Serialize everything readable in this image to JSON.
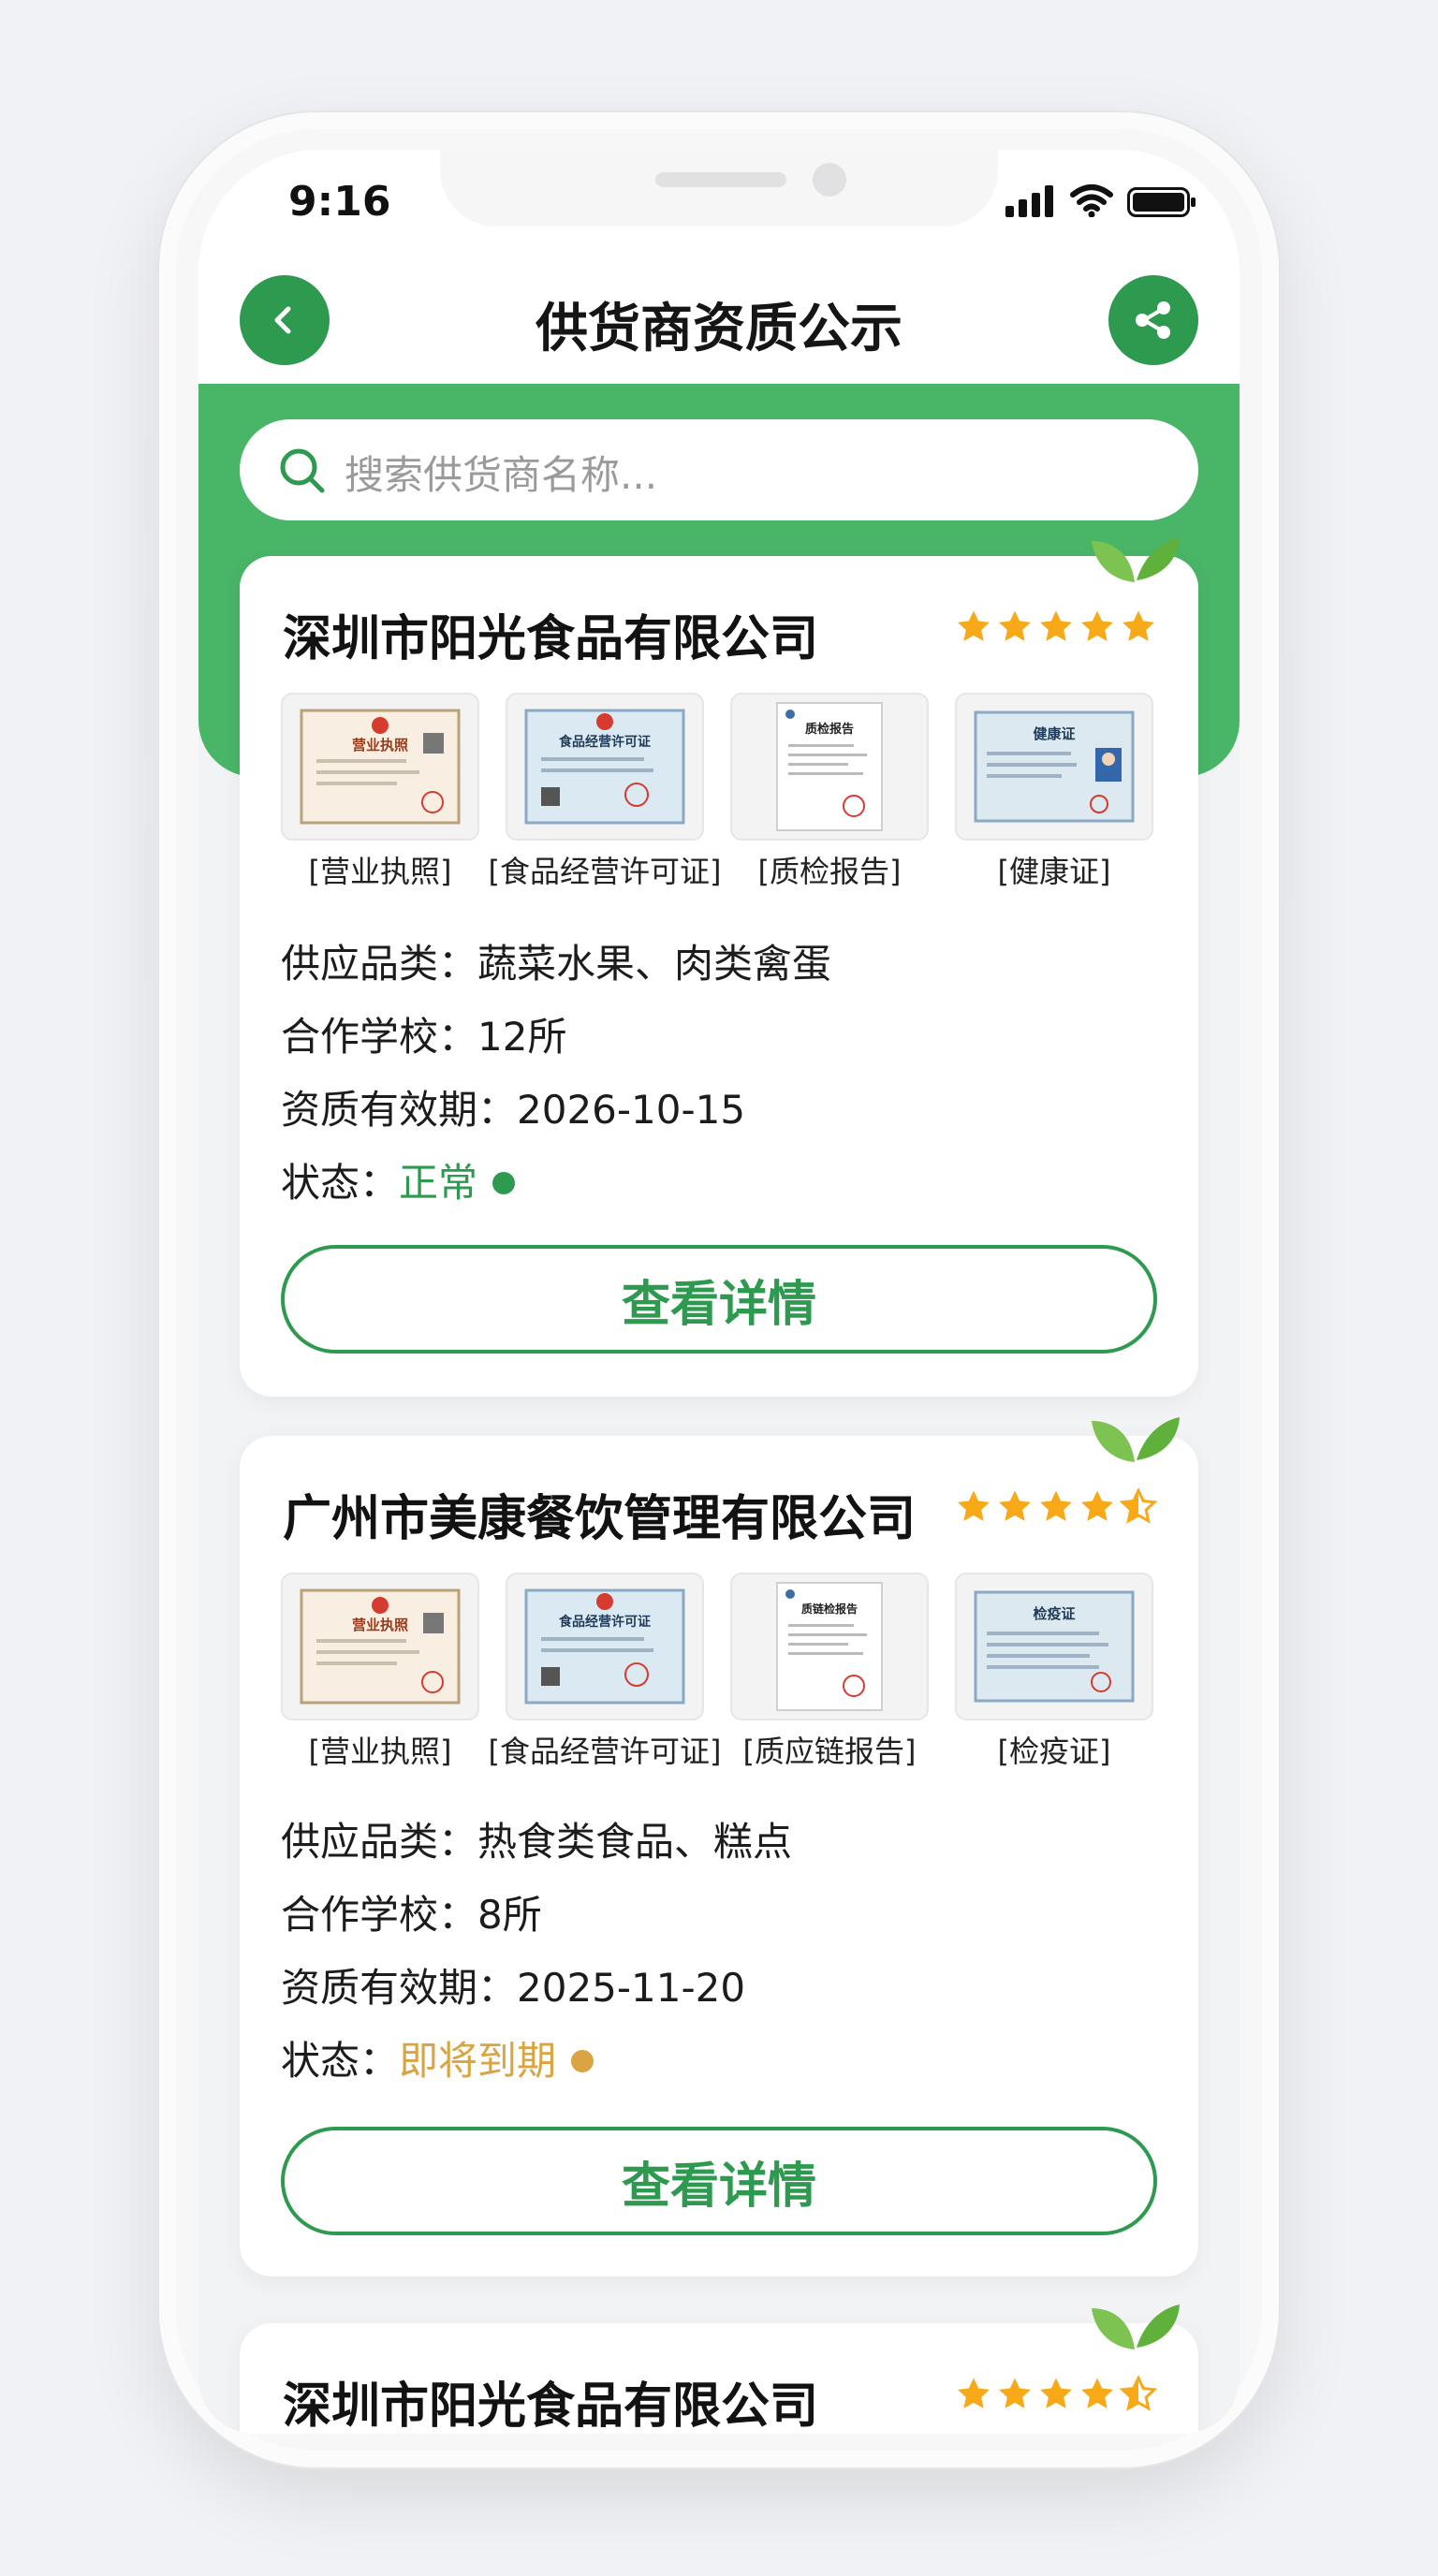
{
  "status_bar": {
    "time": "9:16"
  },
  "header": {
    "title": "供货商资质公示"
  },
  "search": {
    "placeholder": "搜索供货商名称..."
  },
  "colors": {
    "brand_green": "#2e9a4f",
    "band_green": "#49b567",
    "star": "#f7a918",
    "warning": "#d9a441"
  },
  "suppliers": [
    {
      "name": "深圳市阳光食品有限公司",
      "rating": 5,
      "documents": [
        {
          "label": "[营业执照]",
          "thumb_title": "营业执照",
          "type": "license"
        },
        {
          "label": "[食品经营许可证]",
          "thumb_title": "食品经营许可证",
          "type": "permit"
        },
        {
          "label": "[质检报告]",
          "thumb_title": "质检报告",
          "type": "report"
        },
        {
          "label": "[健康证]",
          "thumb_title": "健康证",
          "type": "health"
        }
      ],
      "category_label": "供应品类：",
      "category": "蔬菜水果、肉类禽蛋",
      "schools_label": "合作学校：",
      "schools": "12所",
      "validity_label": "资质有效期：",
      "validity": "2026-10-15",
      "status_label": "状态：",
      "status": "正常",
      "button": "查看详情"
    },
    {
      "name": "广州市美康餐饮管理有限公司",
      "rating": 4.5,
      "documents": [
        {
          "label": "[营业执照]",
          "thumb_title": "营业执照",
          "type": "license"
        },
        {
          "label": "[食品经营许可证]",
          "thumb_title": "食品经营许可证",
          "type": "permit"
        },
        {
          "label": "[质应链报告]",
          "thumb_title": "质链检报告",
          "type": "report"
        },
        {
          "label": "[检疫证]",
          "thumb_title": "检疫证",
          "type": "quarantine"
        }
      ],
      "category_label": "供应品类：",
      "category": "热食类食品、糕点",
      "schools_label": "合作学校：",
      "schools": "8所",
      "validity_label": "资质有效期：",
      "validity": "2025-11-20",
      "status_label": "状态：",
      "status": "即将到期",
      "button": "查看详情"
    },
    {
      "name": "深圳市阳光食品有限公司",
      "rating": 4.5
    }
  ]
}
